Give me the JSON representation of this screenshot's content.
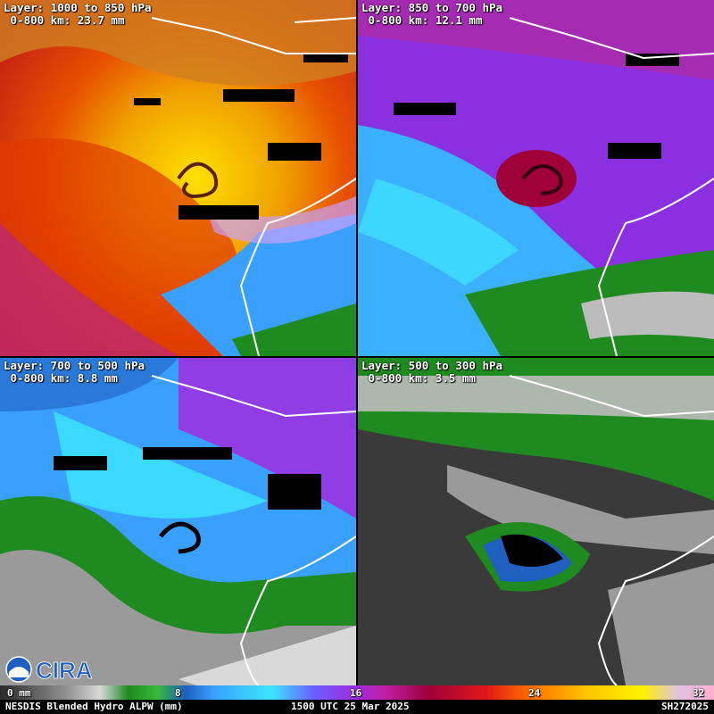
{
  "panels": [
    {
      "layer": "Layer: 1000 to 850 hPa",
      "mean": "0-800 km: 23.7 mm"
    },
    {
      "layer": "Layer: 850 to 700 hPa",
      "mean": "0-800 km: 12.1 mm"
    },
    {
      "layer": "Layer: 700 to 500 hPa",
      "mean": "0-800 km: 8.8 mm"
    },
    {
      "layer": "Layer: 500 to 300 hPa",
      "mean": "0-800 km: 3.5 mm"
    }
  ],
  "colorbar": {
    "ticks": [
      "0 mm",
      "8",
      "16",
      "24",
      "32"
    ]
  },
  "footer": {
    "product": "NESDIS Blended Hydro ALPW (mm)",
    "time": "1500 UTC 25 Mar 2025",
    "id": "SH272025"
  },
  "logo": {
    "name": "CIRA",
    "agency_icon": "noaa-logo-icon"
  }
}
